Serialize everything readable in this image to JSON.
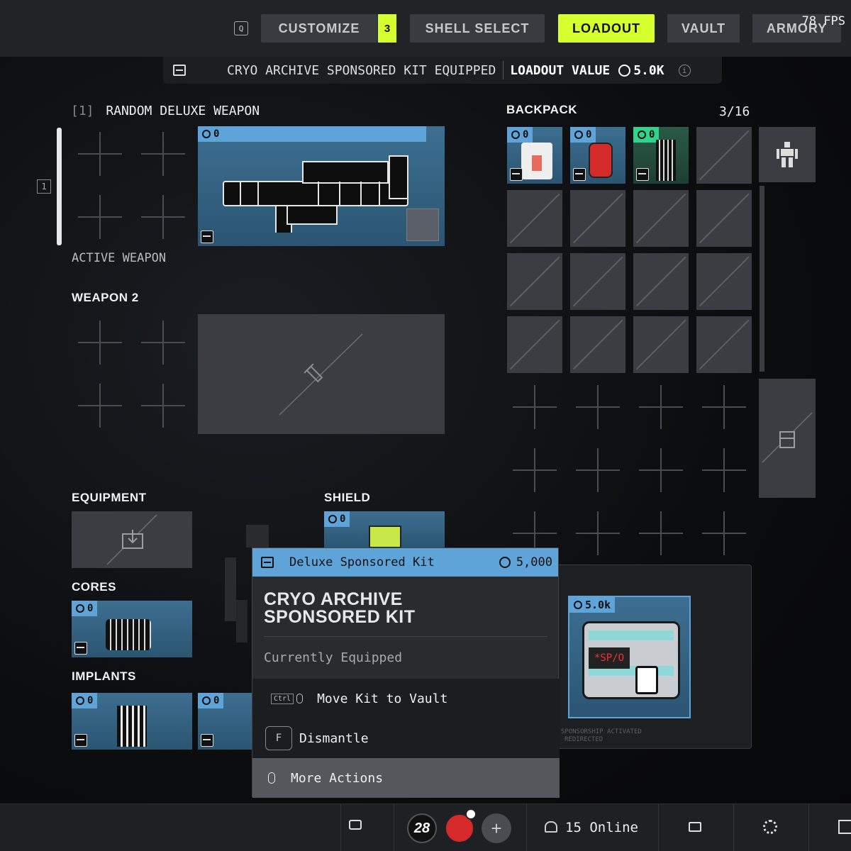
{
  "topbar": {
    "key_hint": "Q",
    "tabs": [
      {
        "label": "CUSTOMIZE",
        "active": false
      },
      {
        "label": "SHELL SELECT",
        "active": false
      },
      {
        "label": "LOADOUT",
        "active": true
      },
      {
        "label": "VAULT",
        "active": false
      },
      {
        "label": "ARMORY",
        "active": false
      }
    ],
    "customize_badge": "3",
    "fps": "78 FPS"
  },
  "infobar": {
    "kit_status": "CRYO ARCHIVE SPONSORED KIT EQUIPPED",
    "loadout_value_label": "LOADOUT VALUE",
    "loadout_value": "5.0K"
  },
  "weapon1": {
    "slot_number": "[1]",
    "title": "RANDOM DELUXE WEAPON",
    "value": "0",
    "side_key": "1",
    "caption": "ACTIVE WEAPON"
  },
  "weapon2": {
    "title": "WEAPON 2"
  },
  "backpack": {
    "title": "BACKPACK",
    "count": "3/16",
    "items": [
      {
        "value": "0",
        "highlight": "#5ea4d8"
      },
      {
        "value": "0",
        "highlight": "#5ea4d8"
      },
      {
        "value": "0",
        "highlight": "#2fd38a"
      }
    ]
  },
  "equipment": {
    "title": "EQUIPMENT"
  },
  "shield": {
    "title": "SHIELD",
    "value": "0"
  },
  "cores": {
    "title": "CORES",
    "value": "0"
  },
  "implants": {
    "title": "IMPLANTS",
    "values": [
      "0",
      "0"
    ]
  },
  "popup": {
    "category": "Deluxe Sponsored Kit",
    "price": "5,000",
    "title_line1": "CRYO ARCHIVE",
    "title_line2": "SPONSORED KIT",
    "status": "Currently Equipped",
    "actions": [
      {
        "key": "Ctrl",
        "label": "Move Kit to Vault"
      },
      {
        "key": "F",
        "label": "Dismantle"
      },
      {
        "key": "mouse",
        "label": "More Actions"
      }
    ]
  },
  "kit_preview": {
    "value": "5.0k",
    "crate_label": "*SP/O",
    "footer_line1": "SPONSORSHIP ACTIVATED",
    "footer_line2": "REDIRECTED"
  },
  "bottombar": {
    "level": "28",
    "online": "15 Online"
  },
  "colors": {
    "accent": "#d6ff2e",
    "rarity_blue": "#5ea4d8",
    "rarity_green": "#2fd38a"
  }
}
